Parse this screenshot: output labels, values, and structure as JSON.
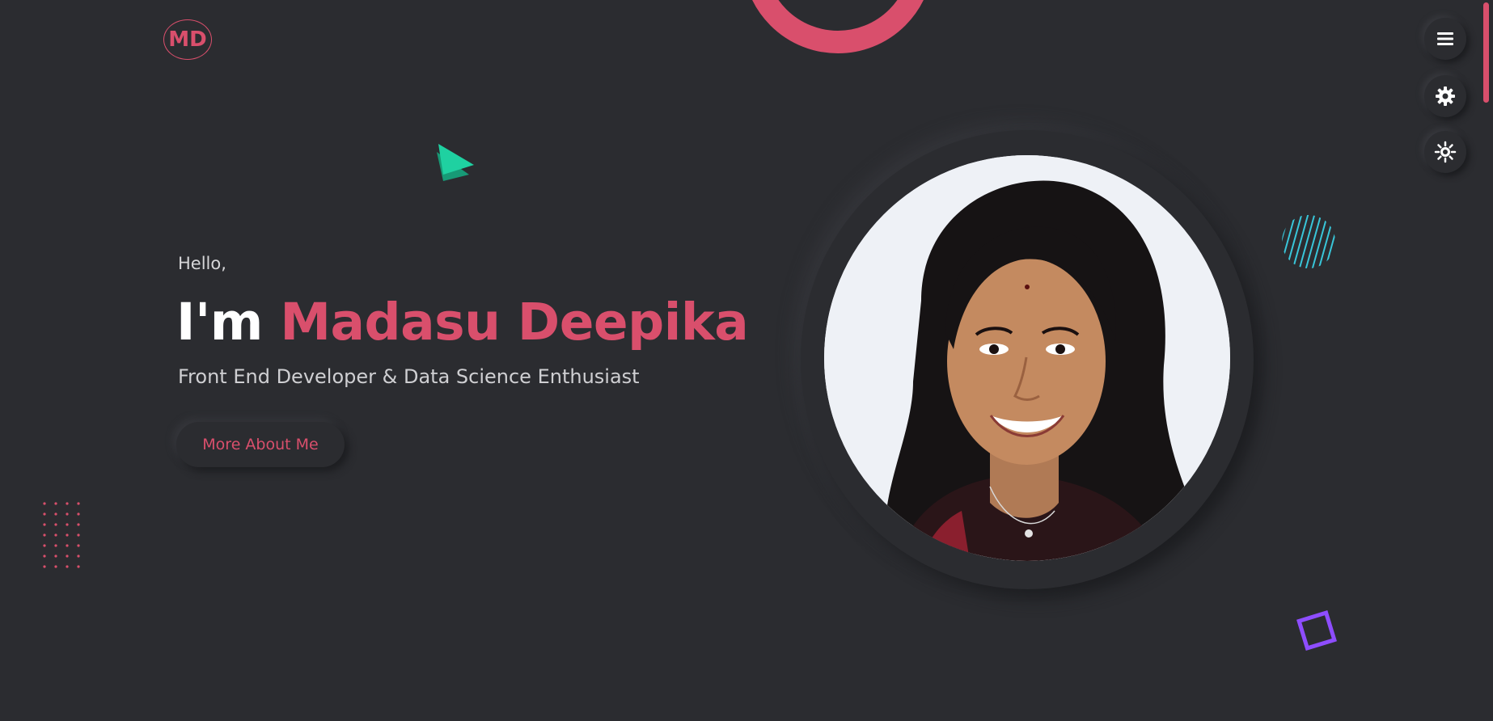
{
  "brand": {
    "logo_text": "MD",
    "accent_color": "#d94f6c",
    "background_color": "#2b2c30"
  },
  "hero": {
    "greeting": "Hello,",
    "intro_prefix": "I'm",
    "name": "Madasu Deepika",
    "tagline": "Front End Developer & Data Science Enthusiast",
    "cta_label": "More About Me"
  },
  "controls": [
    {
      "icon": "menu-icon"
    },
    {
      "icon": "gear-icon"
    },
    {
      "icon": "sun-icon"
    }
  ],
  "decorations": {
    "triangle_color": "#1fd1a1",
    "stripes_color": "#39c6d9",
    "square_color": "#8e4dff",
    "dots_color": "#d94f6c"
  }
}
